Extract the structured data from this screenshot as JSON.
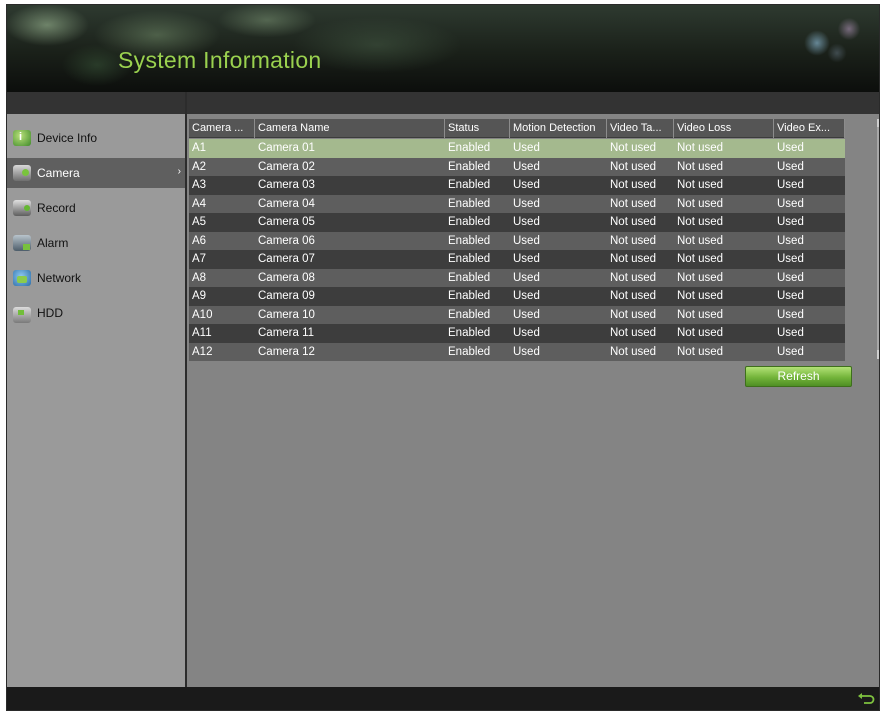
{
  "header": {
    "title": "System Information"
  },
  "sidebar": {
    "items": [
      {
        "label": "Device Info",
        "icon": "info-icon",
        "active": false
      },
      {
        "label": "Camera",
        "icon": "camera-icon",
        "active": true
      },
      {
        "label": "Record",
        "icon": "record-icon",
        "active": false
      },
      {
        "label": "Alarm",
        "icon": "alarm-icon",
        "active": false
      },
      {
        "label": "Network",
        "icon": "network-icon",
        "active": false
      },
      {
        "label": "HDD",
        "icon": "hdd-icon",
        "active": false
      }
    ]
  },
  "table": {
    "columns": [
      "Camera ...",
      "Camera Name",
      "Status",
      "Motion Detection",
      "Video Ta...",
      "Video Loss",
      "Video Ex..."
    ],
    "selected_row": 0,
    "rows": [
      [
        "A1",
        "Camera 01",
        "Enabled",
        "Used",
        "Not used",
        "Not used",
        "Used"
      ],
      [
        "A2",
        "Camera 02",
        "Enabled",
        "Used",
        "Not used",
        "Not used",
        "Used"
      ],
      [
        "A3",
        "Camera 03",
        "Enabled",
        "Used",
        "Not used",
        "Not used",
        "Used"
      ],
      [
        "A4",
        "Camera 04",
        "Enabled",
        "Used",
        "Not used",
        "Not used",
        "Used"
      ],
      [
        "A5",
        "Camera 05",
        "Enabled",
        "Used",
        "Not used",
        "Not used",
        "Used"
      ],
      [
        "A6",
        "Camera 06",
        "Enabled",
        "Used",
        "Not used",
        "Not used",
        "Used"
      ],
      [
        "A7",
        "Camera 07",
        "Enabled",
        "Used",
        "Not used",
        "Not used",
        "Used"
      ],
      [
        "A8",
        "Camera 08",
        "Enabled",
        "Used",
        "Not used",
        "Not used",
        "Used"
      ],
      [
        "A9",
        "Camera 09",
        "Enabled",
        "Used",
        "Not used",
        "Not used",
        "Used"
      ],
      [
        "A10",
        "Camera 10",
        "Enabled",
        "Used",
        "Not used",
        "Not used",
        "Used"
      ],
      [
        "A11",
        "Camera 11",
        "Enabled",
        "Used",
        "Not used",
        "Not used",
        "Used"
      ],
      [
        "A12",
        "Camera 12",
        "Enabled",
        "Used",
        "Not used",
        "Not used",
        "Used"
      ]
    ]
  },
  "actions": {
    "refresh_label": "Refresh"
  },
  "footer": {
    "back_icon": "back-arrow-icon"
  },
  "colors": {
    "title_green": "#9ad14f",
    "selected_row": "#a4b98e",
    "button_green": "#73b43a"
  }
}
